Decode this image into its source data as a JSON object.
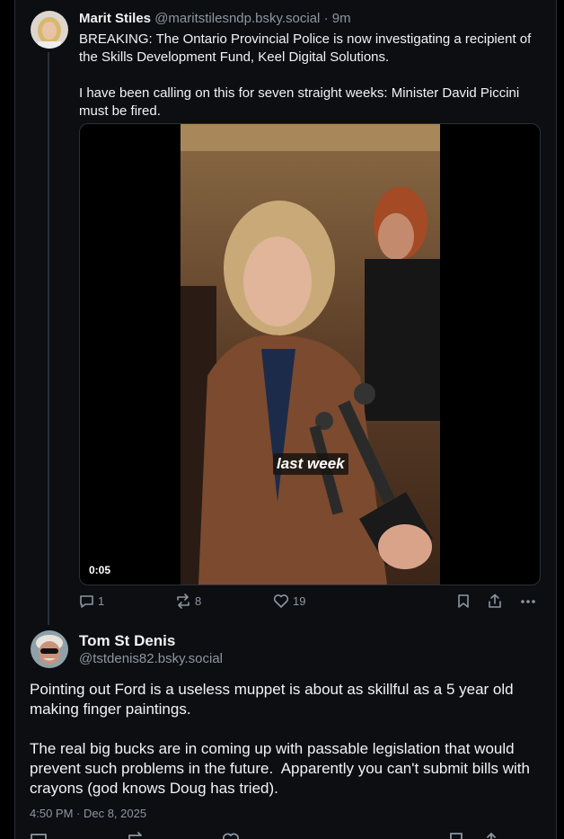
{
  "post1": {
    "author_name": "Marit Stiles",
    "author_handle": "@maritstilesndp.bsky.social",
    "separator": "·",
    "time_ago": "9m",
    "text": "BREAKING: The Ontario Provincial Police is now investigating a recipient of the Skills Development Fund, Keel Digital Solutions.\n\nI have been calling on this for seven straight weeks: Minister David Piccini must be fired.",
    "video": {
      "caption": "last week",
      "timecode": "0:05"
    },
    "actions": {
      "reply_count": "1",
      "repost_count": "8",
      "like_count": "19"
    }
  },
  "post2": {
    "author_name": "Tom St Denis",
    "author_handle": "@tstdenis82.bsky.social",
    "text": "Pointing out Ford is a useless muppet is about as skillful as a 5 year old making finger paintings.\n\nThe real big bucks are in coming up with passable legislation that would prevent such problems in the future.  Apparently you can't submit bills with crayons (god knows Doug has tried).",
    "timestamp": "4:50 PM · Dec 8, 2025"
  },
  "colors": {
    "background": "#000000",
    "panel": "#0c0e11",
    "text_primary": "#f1f3f5",
    "text_secondary": "#8c96a3",
    "border": "#2a2f36"
  },
  "icons": [
    "reply-icon",
    "repost-icon",
    "like-icon",
    "bookmark-icon",
    "share-icon",
    "more-icon"
  ]
}
